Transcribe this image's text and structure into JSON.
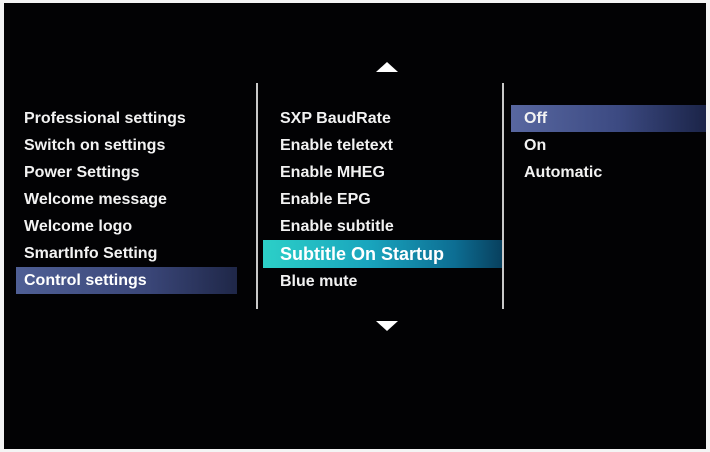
{
  "menu": {
    "categories": [
      {
        "label": "Professional settings"
      },
      {
        "label": "Switch on settings"
      },
      {
        "label": "Power Settings"
      },
      {
        "label": "Welcome message"
      },
      {
        "label": "Welcome logo"
      },
      {
        "label": "SmartInfo Setting"
      },
      {
        "label": "Control settings"
      }
    ],
    "selected_category": "Control settings"
  },
  "submenu": {
    "items": [
      {
        "label": "SXP BaudRate"
      },
      {
        "label": "Enable teletext"
      },
      {
        "label": "Enable MHEG"
      },
      {
        "label": "Enable EPG"
      },
      {
        "label": "Enable subtitle"
      },
      {
        "label": "Subtitle On Startup"
      },
      {
        "label": "Blue mute"
      }
    ],
    "focused_item": "Subtitle On Startup"
  },
  "options": {
    "items": [
      {
        "label": "Off"
      },
      {
        "label": "On"
      },
      {
        "label": "Automatic"
      }
    ],
    "selected_value": "Off"
  },
  "navigation": {
    "up_icon": "triangle-up-icon",
    "down_icon": "triangle-down-icon"
  },
  "colors": {
    "background": "#020204",
    "text": "#f2f2f2",
    "focus_highlight": "#19a4bd",
    "selection_highlight": "#4f5f95",
    "divider": "#c9c9c9"
  }
}
